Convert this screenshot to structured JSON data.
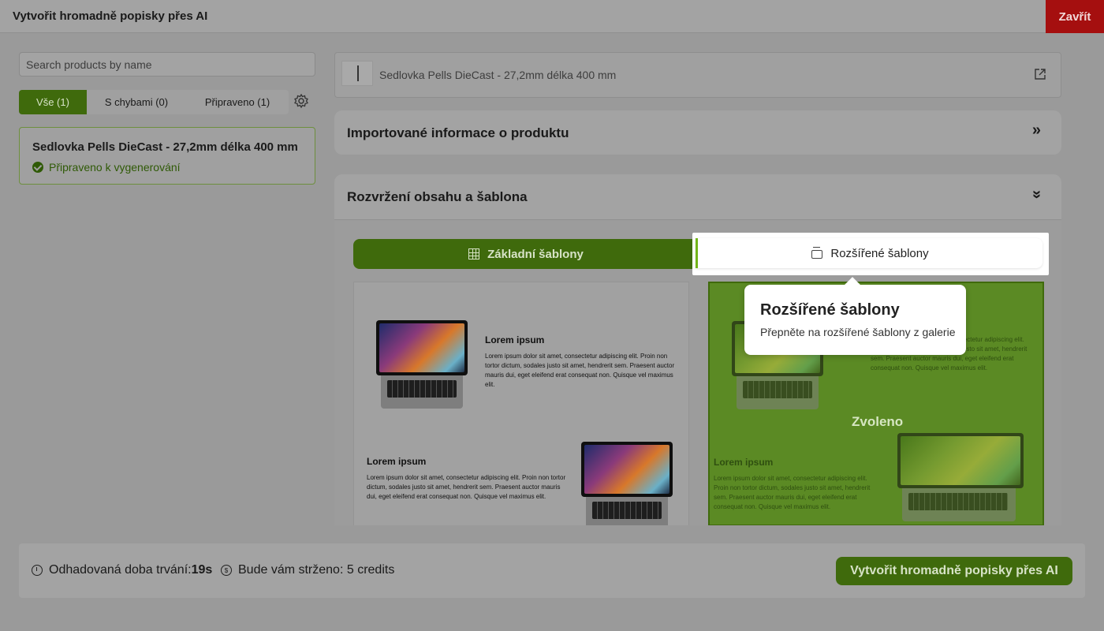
{
  "header": {
    "title": "Vytvořit hromadně popisky přes AI",
    "close_label": "Zavřít"
  },
  "sidebar": {
    "search_placeholder": "Search products by name",
    "filters": [
      {
        "label": "Vše (1)",
        "active": true
      },
      {
        "label": "S chybami (0)",
        "active": false
      },
      {
        "label": "Připraveno (1)",
        "active": false
      }
    ],
    "product": {
      "name": "Sedlovka Pells DieCast - 27,2mm délka 400 mm",
      "status": "Připraveno k vygenerování"
    }
  },
  "main": {
    "product_name": "Sedlovka Pells DieCast - 27,2mm délka 400 mm",
    "imported_title": "Importované informace o produktu",
    "layout_title": "Rozvržení obsahu a šablona",
    "tabs": {
      "basic": "Základní šablony",
      "advanced": "Rozšířené šablony"
    },
    "template_basic": {
      "block1_title": "Lorem ipsum",
      "block1_text": "Lorem ipsum dolor sit amet, consectetur adipiscing elit. Proin non tortor dictum, sodales justo sit amet, hendrerit sem. Praesent auctor mauris dui, eget eleifend erat consequat non. Quisque vel maximus elit.",
      "block2_title": "Lorem ipsum",
      "block2_text": "Lorem ipsum dolor sit amet, consectetur adipiscing elit. Proin non tortor dictum, sodales justo sit amet, hendrerit sem. Praesent auctor mauris dui, eget eleifend erat consequat non. Quisque vel maximus elit."
    },
    "template_advanced": {
      "selected_label": "Zvoleno",
      "block1_text": "Lorem ipsum dolor sit amet, consectetur adipiscing elit. Proin non tortor dictum, sodales justo sit amet, hendrerit sem. Praesent auctor mauris dui, eget eleifend erat consequat non. Quisque vel maximus elit.",
      "block2_title": "Lorem ipsum",
      "block2_text": "Lorem ipsum dolor sit amet, consectetur adipiscing elit. Proin non tortor dictum, sodales justo sit amet, hendrerit sem. Praesent auctor mauris dui, eget eleifend erat consequat non. Quisque vel maximus elit."
    }
  },
  "tooltip": {
    "title": "Rozšířené šablony",
    "text": "Přepněte na rozšířené šablony z galerie"
  },
  "footer": {
    "duration_label": "Odhadovaná doba trvání:",
    "duration_value": "19s",
    "cost_label": "Bude vám strženo: 5 credits",
    "generate_label": "Vytvořit hromadně popisky přes AI"
  },
  "colors": {
    "brand_green": "#3f6a0c",
    "close_red": "#a50f0f",
    "highlight_accent": "#73b51a"
  }
}
